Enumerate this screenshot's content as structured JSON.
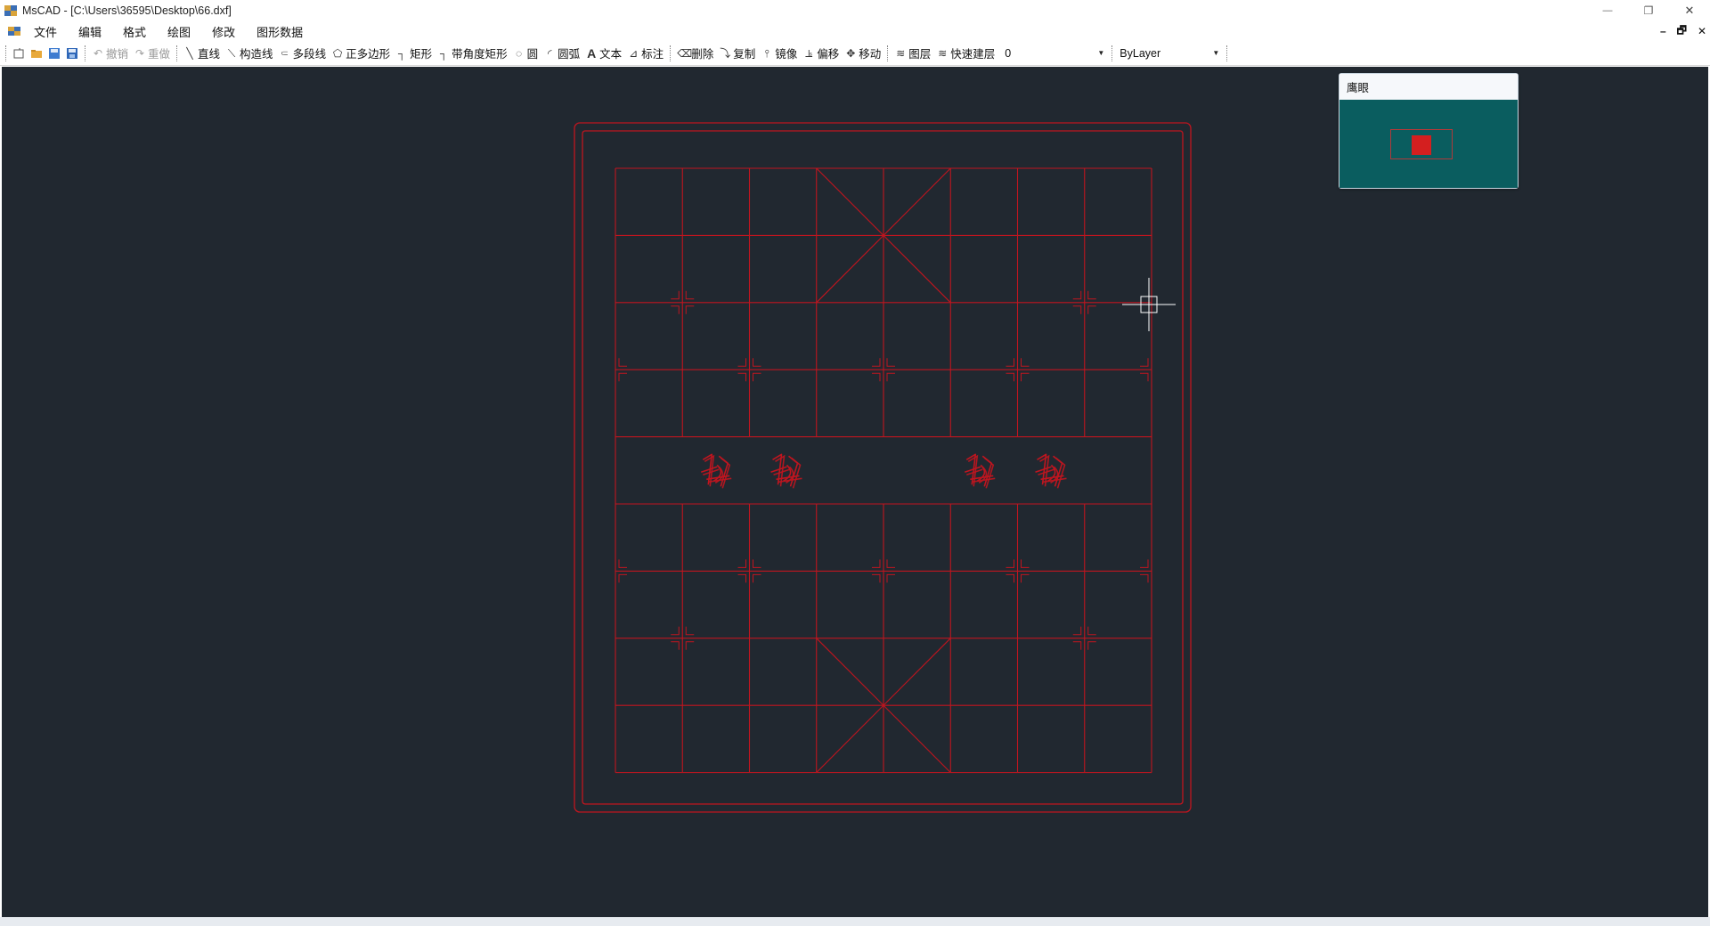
{
  "window": {
    "title": "MsCAD - [C:\\Users\\36595\\Desktop\\66.dxf]",
    "minimize_glyph": "—",
    "restore_glyph": "❐",
    "close_glyph": "✕"
  },
  "menu": {
    "items": [
      "文件",
      "编辑",
      "格式",
      "绘图",
      "修改",
      "图形数据"
    ],
    "mdi_min": "–",
    "mdi_restore": "🗗",
    "mdi_close": "✕"
  },
  "toolbar": {
    "undo": "撤销",
    "redo": "重做",
    "line": "直线",
    "construct_line": "构造线",
    "polyline": "多段线",
    "polygon": "正多边形",
    "rect": "矩形",
    "angle_rect": "带角度矩形",
    "circle": "圆",
    "arc": "圆弧",
    "text": "文本",
    "dimension": "标注",
    "delete": "删除",
    "copy": "复制",
    "mirror": "镜像",
    "offset": "偏移",
    "move": "移动",
    "layer": "图层",
    "quick_layer": "快速建层",
    "layer_value": "0",
    "linetype_value": "ByLayer"
  },
  "eagle_eye": {
    "title": "鹰眼"
  },
  "colors": {
    "canvas_bg": "#212830",
    "drawing": "#c0151f",
    "eagle_bg": "#0a5d5f",
    "crosshair": "#ffffff"
  },
  "icons": [
    "new-file-icon",
    "open-folder-icon",
    "save-icon",
    "save-as-icon",
    "undo-icon",
    "redo-icon",
    "line-icon",
    "construct-line-icon",
    "polyline-icon",
    "polygon-icon",
    "rectangle-icon",
    "angle-rectangle-icon",
    "circle-icon",
    "arc-icon",
    "text-icon",
    "dimension-icon",
    "eraser-icon",
    "copy-icon",
    "mirror-icon",
    "offset-icon",
    "move-icon",
    "layers-icon",
    "quick-layer-icon"
  ]
}
